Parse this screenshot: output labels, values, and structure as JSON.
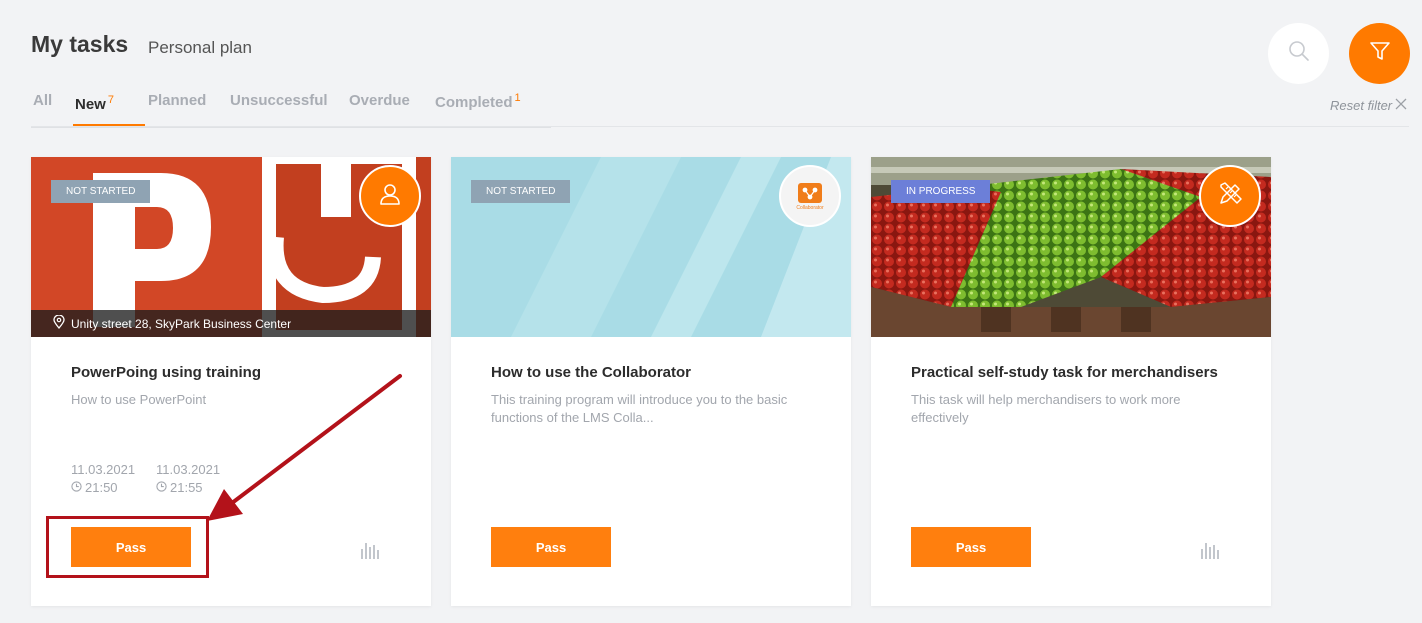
{
  "header": {
    "title": "My tasks",
    "subtitle": "Personal plan"
  },
  "tabs": [
    {
      "label": "All",
      "count": ""
    },
    {
      "label": "New",
      "count": "7"
    },
    {
      "label": "Planned",
      "count": ""
    },
    {
      "label": "Unsuccessful",
      "count": ""
    },
    {
      "label": "Overdue",
      "count": ""
    },
    {
      "label": "Completed",
      "count": "1"
    }
  ],
  "active_tab": "New",
  "toolbar": {
    "search_icon": "search-icon",
    "filter_icon": "funnel-icon",
    "reset_filter_label": "Reset filter"
  },
  "colors": {
    "accent": "#ff7a00",
    "not_started_badge": "#8fa3b3",
    "in_progress_badge": "#6c7fd8",
    "annotation": "#b3121a"
  },
  "cards": [
    {
      "status": "NOT STARTED",
      "type_icon": "user-icon",
      "image": "powerpoint-logo",
      "location": "Unity street 28, SkyPark Business Center",
      "title": "PowerPoing using training",
      "description": "How to use PowerPoint",
      "start_date": "11.03.2021",
      "start_time": "21:50",
      "end_date": "11.03.2021",
      "end_time": "21:55",
      "button_label": "Pass"
    },
    {
      "status": "NOT STARTED",
      "type_icon": "collaborator-logo-icon",
      "logo_text": "Collaborator",
      "image": "light-blue-pattern",
      "title": "How to use the Collaborator",
      "description": "This training program will introduce you to the basic functions of the LMS Colla...",
      "button_label": "Pass"
    },
    {
      "status": "IN PROGRESS",
      "type_icon": "pencil-ruler-icon",
      "image": "fruit-market-photo",
      "title": "Practical self-study task for merchandisers",
      "description": "This task will help merchandisers to work more effectively",
      "button_label": "Pass"
    }
  ]
}
